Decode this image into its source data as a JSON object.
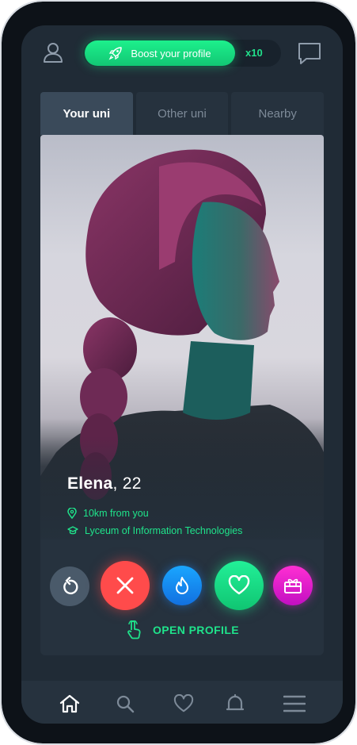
{
  "header": {
    "boost_label": "Boost your profile",
    "boost_count": "x10",
    "icons": {
      "user": "user-icon",
      "rocket": "rocket-icon",
      "chat": "chat-icon"
    }
  },
  "tabs": [
    {
      "label": "Your uni",
      "active": true
    },
    {
      "label": "Other uni",
      "active": false
    },
    {
      "label": "Nearby",
      "active": false
    }
  ],
  "profile": {
    "name": "Elena",
    "age_text": ", 22",
    "distance": "10km from you",
    "school": "Lyceum of Information Technologies"
  },
  "actions": {
    "icons": [
      "undo-icon",
      "close-icon",
      "flame-icon",
      "heart-icon",
      "gift-icon"
    ],
    "open_profile_label": "OPEN PROFILE"
  },
  "bottom_nav": {
    "items": [
      "home-icon",
      "search-icon",
      "heart-icon",
      "bell-icon",
      "menu-icon"
    ]
  },
  "colors": {
    "accent_green": "#1fe38b",
    "nope_red": "#ff4b4b",
    "super_blue": "#1a8cff",
    "gift_magenta": "#e81fd0",
    "background": "#202b36"
  }
}
